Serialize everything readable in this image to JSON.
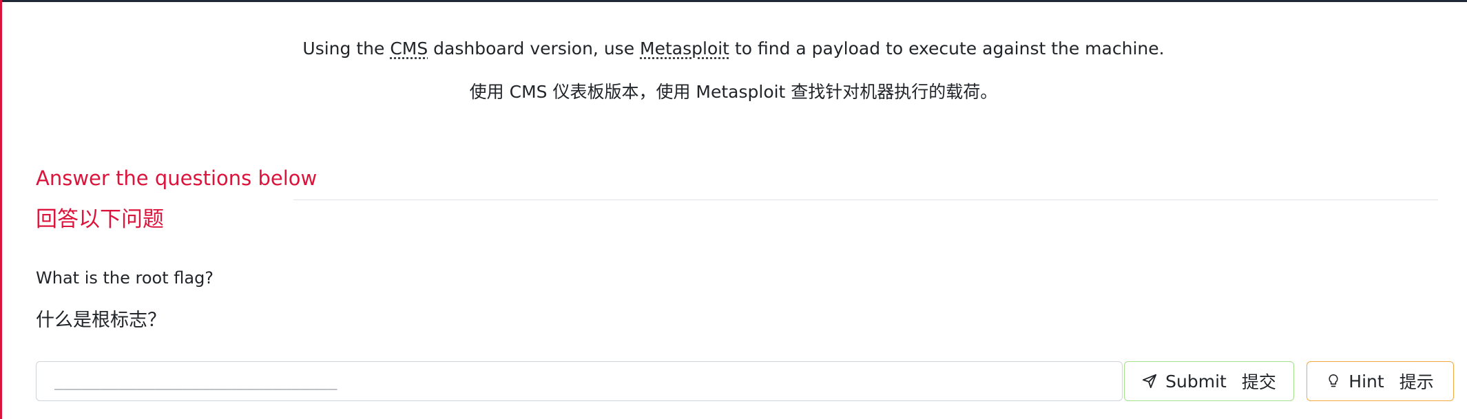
{
  "task": {
    "english": {
      "before_cms": "Using the ",
      "cms": "CMS",
      "between": " dashboard version, use ",
      "metasploit": "Metasploit",
      "after": " to find a payload to execute against the machine."
    },
    "chinese": "使用 CMS 仪表板版本，使用 Metasploit 查找针对机器执行的载荷。"
  },
  "answer_section": {
    "heading_en": "Answer the questions below",
    "heading_cn": "回答以下问题"
  },
  "question": {
    "text_en": "What is the root flag?",
    "text_cn": "什么是根标志？",
    "answer_placeholder": "_______________________________"
  },
  "buttons": {
    "submit_label": "Submit",
    "submit_label_cn": "提交",
    "hint_label": "Hint",
    "hint_label_cn": "提示"
  },
  "icons": {
    "submit": "paper-plane-icon",
    "hint": "lightbulb-icon"
  },
  "colors": {
    "accent_red": "#dc143c",
    "submit_border": "#a6e08a",
    "hint_border": "#f5a742"
  }
}
